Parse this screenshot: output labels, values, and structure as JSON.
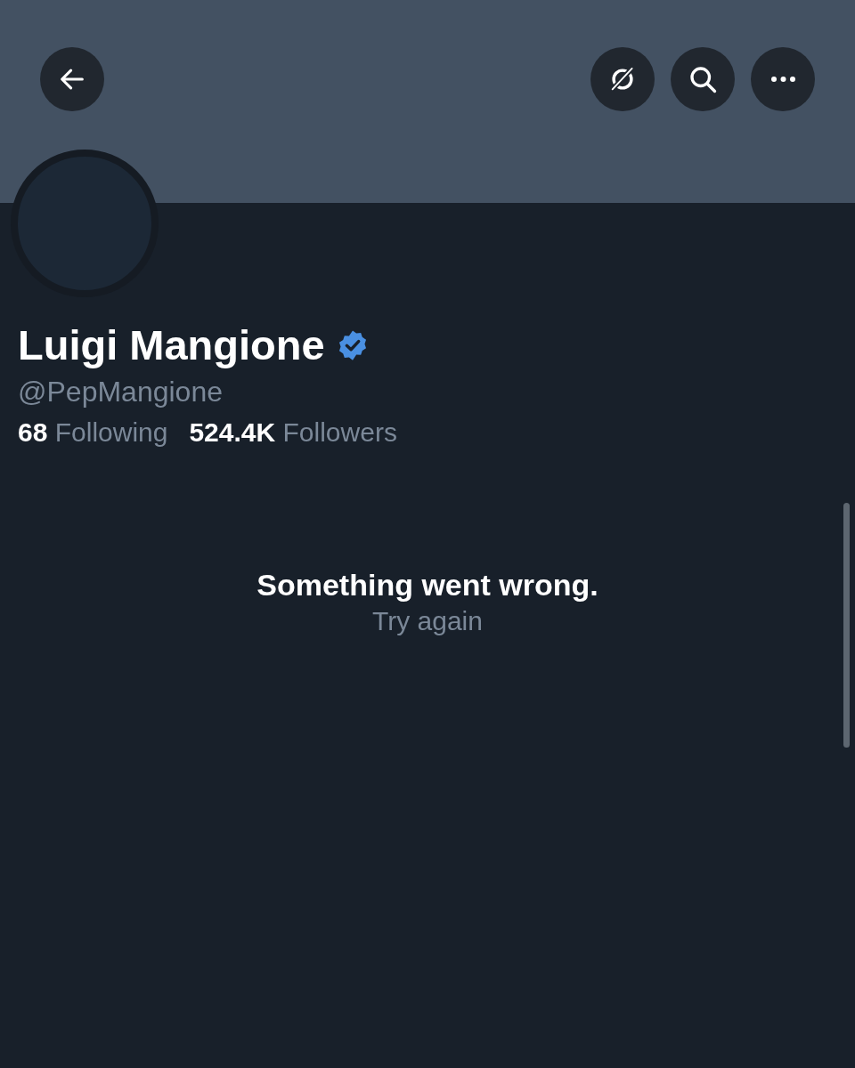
{
  "header": {
    "buttons": [
      {
        "kind": "back"
      },
      {
        "kind": "grok"
      },
      {
        "kind": "search"
      },
      {
        "kind": "more"
      }
    ]
  },
  "profile": {
    "name": "Luigi Mangione",
    "verified": true,
    "handle": "@PepMangione",
    "stats": [
      {
        "text": "**68** Following"
      },
      {
        "text": "**524.4K** Followers"
      }
    ]
  },
  "error": {
    "title": "Something went wrong.",
    "action": "Try again"
  }
}
